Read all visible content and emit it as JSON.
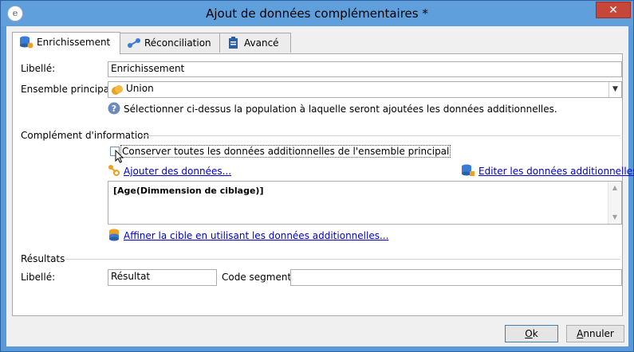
{
  "window": {
    "title": "Ajout de données complémentaires *",
    "close": "✕"
  },
  "tabs": [
    {
      "label": "Enrichissement",
      "icon": "database-icon"
    },
    {
      "label": "Réconciliation",
      "icon": "link-nodes-icon"
    },
    {
      "label": "Avancé",
      "icon": "clipboard-icon"
    }
  ],
  "form": {
    "libelle_label": "Libellé:",
    "libelle_value": "Enrichissement",
    "ensemble_label": "Ensemble principal:",
    "ensemble_value": "Union",
    "help_text": "Sélectionner ci-dessus la population à laquelle seront ajoutées les données additionnelles."
  },
  "complement": {
    "section_title": "Complément d'information",
    "checkbox_label": "Conserver toutes les données additionnelles de l'ensemble principal",
    "add_link": "Ajouter des données...",
    "edit_link": "Editer les données additionnelles...",
    "list_item": "[Age(Dimmension de ciblage)]",
    "refine_link": "Affiner la cible en utilisant les données additionnelles..."
  },
  "results": {
    "section_title": "Résultats",
    "libelle_label": "Libellé:",
    "libelle_value": "Résultat",
    "code_label": "Code segment:",
    "code_value": ""
  },
  "buttons": {
    "ok_underlined": "O",
    "ok_rest": "k",
    "cancel_underlined": "A",
    "cancel_rest": "nnuler"
  }
}
